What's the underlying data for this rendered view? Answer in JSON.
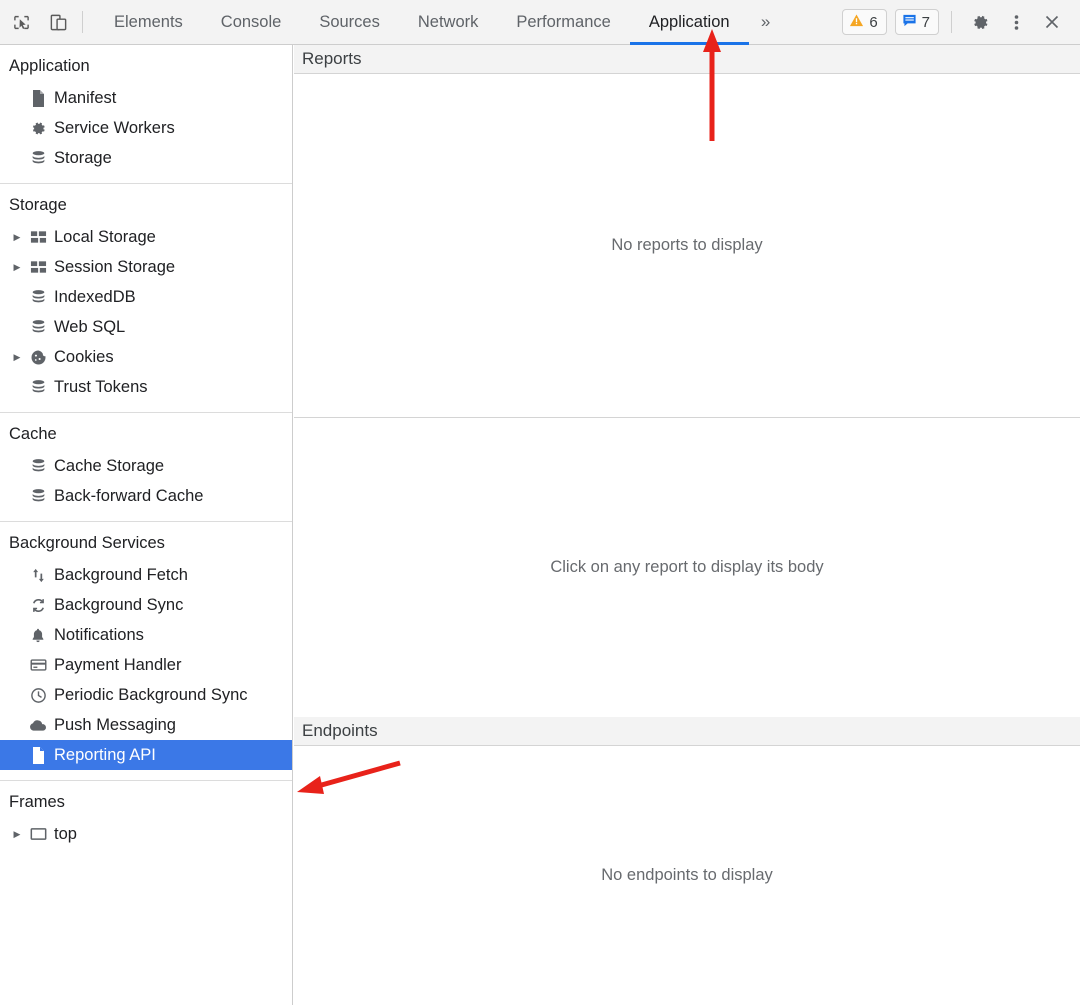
{
  "toolbar": {
    "inspect_icon": "inspect-cursor-icon",
    "device_icon": "device-toolbar-icon",
    "tabs": [
      {
        "label": "Elements",
        "active": false
      },
      {
        "label": "Console",
        "active": false
      },
      {
        "label": "Sources",
        "active": false
      },
      {
        "label": "Network",
        "active": false
      },
      {
        "label": "Performance",
        "active": false
      },
      {
        "label": "Application",
        "active": true
      }
    ],
    "more_tabs_label": "»",
    "warnings": {
      "icon": "warning-triangle-icon",
      "count": "6",
      "color": "#f5a623"
    },
    "messages": {
      "icon": "message-bubble-icon",
      "count": "7",
      "color": "#1a73e8"
    },
    "settings_icon": "gear-icon",
    "more_icon": "kebab-menu-icon",
    "close_icon": "close-icon",
    "accent_color": "#1a73e8"
  },
  "sidebar": {
    "sections": [
      {
        "title": "Application",
        "items": [
          {
            "label": "Manifest",
            "icon": "document-icon",
            "expandable": false,
            "selected": false
          },
          {
            "label": "Service Workers",
            "icon": "gear-icon",
            "expandable": false,
            "selected": false
          },
          {
            "label": "Storage",
            "icon": "database-icon",
            "expandable": false,
            "selected": false
          }
        ]
      },
      {
        "title": "Storage",
        "items": [
          {
            "label": "Local Storage",
            "icon": "table-icon",
            "expandable": true,
            "selected": false
          },
          {
            "label": "Session Storage",
            "icon": "table-icon",
            "expandable": true,
            "selected": false
          },
          {
            "label": "IndexedDB",
            "icon": "database-icon",
            "expandable": false,
            "selected": false
          },
          {
            "label": "Web SQL",
            "icon": "database-icon",
            "expandable": false,
            "selected": false
          },
          {
            "label": "Cookies",
            "icon": "cookie-icon",
            "expandable": true,
            "selected": false
          },
          {
            "label": "Trust Tokens",
            "icon": "database-icon",
            "expandable": false,
            "selected": false
          }
        ]
      },
      {
        "title": "Cache",
        "items": [
          {
            "label": "Cache Storage",
            "icon": "database-icon",
            "expandable": false,
            "selected": false
          },
          {
            "label": "Back-forward Cache",
            "icon": "database-icon",
            "expandable": false,
            "selected": false
          }
        ]
      },
      {
        "title": "Background Services",
        "items": [
          {
            "label": "Background Fetch",
            "icon": "up-down-arrows-icon",
            "expandable": false,
            "selected": false
          },
          {
            "label": "Background Sync",
            "icon": "sync-icon",
            "expandable": false,
            "selected": false
          },
          {
            "label": "Notifications",
            "icon": "bell-icon",
            "expandable": false,
            "selected": false
          },
          {
            "label": "Payment Handler",
            "icon": "credit-card-icon",
            "expandable": false,
            "selected": false
          },
          {
            "label": "Periodic Background Sync",
            "icon": "clock-icon",
            "expandable": false,
            "selected": false
          },
          {
            "label": "Push Messaging",
            "icon": "cloud-icon",
            "expandable": false,
            "selected": false
          },
          {
            "label": "Reporting API",
            "icon": "document-icon",
            "expandable": false,
            "selected": true
          }
        ]
      },
      {
        "title": "Frames",
        "items": [
          {
            "label": "top",
            "icon": "frame-icon",
            "expandable": true,
            "selected": false
          }
        ]
      }
    ],
    "selection_color": "#3b78e7"
  },
  "main": {
    "reports_panel": {
      "header": "Reports",
      "empty_text": "No reports to display"
    },
    "body_panel": {
      "empty_text": "Click on any report to display its body"
    },
    "endpoints_panel": {
      "header": "Endpoints",
      "empty_text": "No endpoints to display"
    }
  },
  "annotations": {
    "color": "#e8221a",
    "arrows": [
      {
        "name": "arrow-to-application-tab",
        "points_at": "Application"
      },
      {
        "name": "arrow-to-reporting-api",
        "points_at": "Reporting API"
      }
    ]
  }
}
